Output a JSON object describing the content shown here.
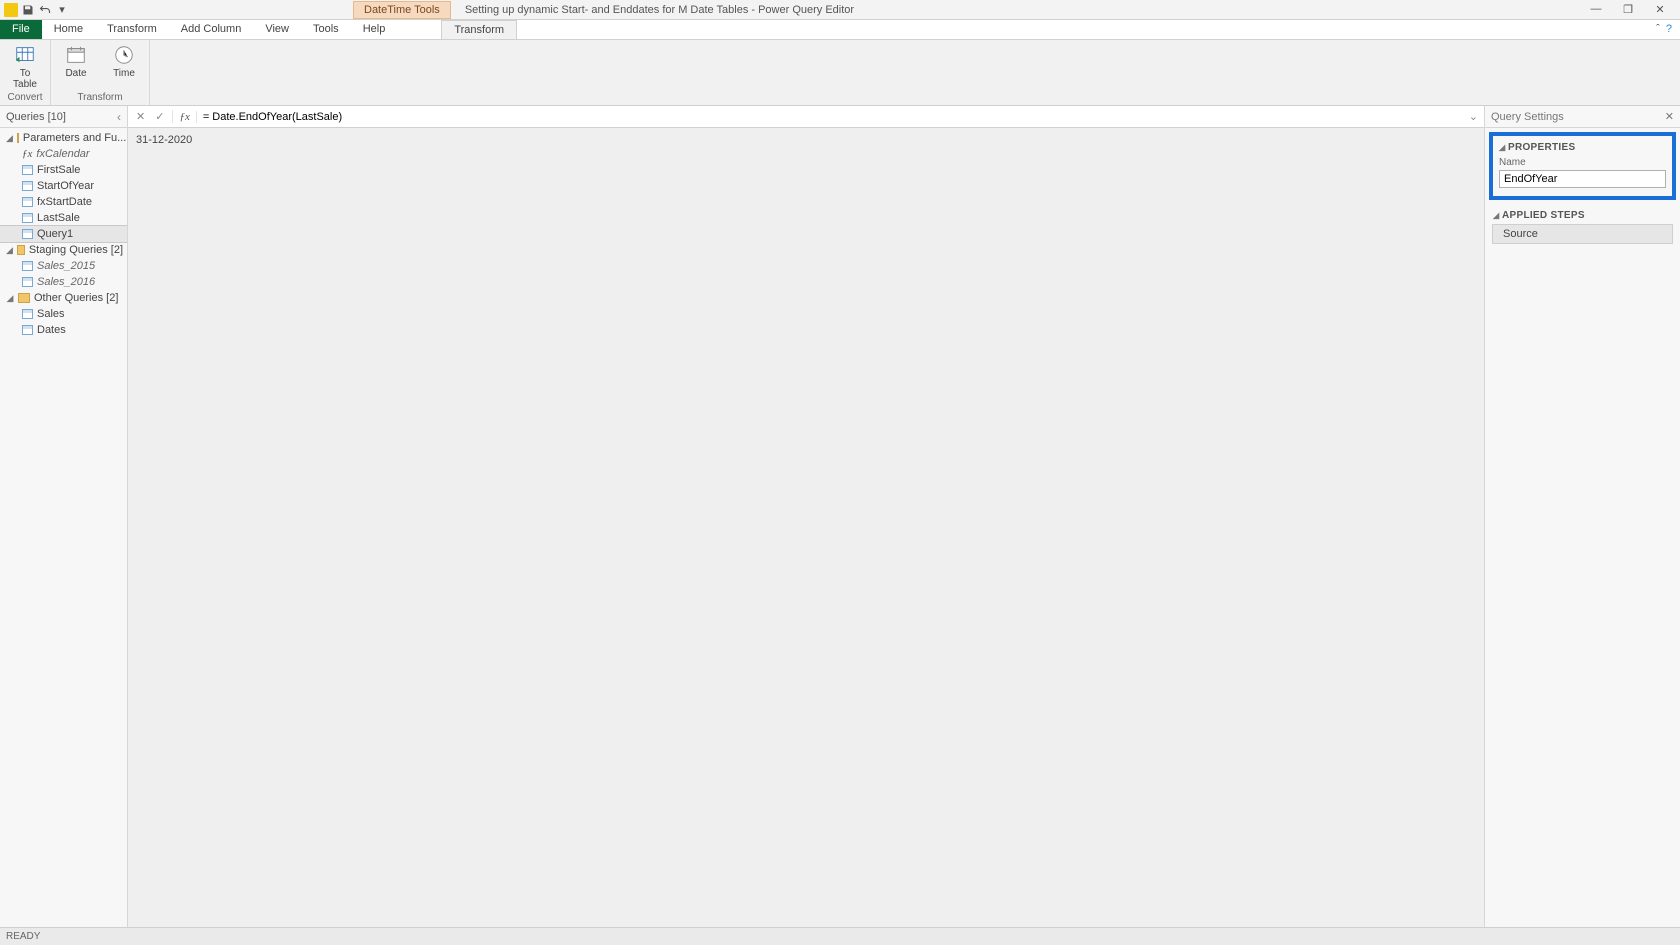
{
  "titlebar": {
    "context_tab": "DateTime Tools",
    "window_title": "Setting up dynamic Start- and Enddates for M Date Tables - Power Query Editor"
  },
  "tabs": {
    "file": "File",
    "home": "Home",
    "transform": "Transform",
    "add_column": "Add Column",
    "view": "View",
    "tools": "Tools",
    "help": "Help",
    "context_transform": "Transform"
  },
  "ribbon": {
    "to_table": "To\nTable",
    "date": "Date",
    "time": "Time",
    "convert_group": "Convert",
    "transform_group": "Transform"
  },
  "queries": {
    "header": "Queries [10]",
    "groups": [
      {
        "name": "Parameters and Fu...",
        "items": [
          {
            "label": "fxCalendar",
            "icon": "fx",
            "italic": true
          },
          {
            "label": "FirstSale",
            "icon": "tbl"
          },
          {
            "label": "StartOfYear",
            "icon": "tbl"
          },
          {
            "label": "fxStartDate",
            "icon": "tbl"
          },
          {
            "label": "LastSale",
            "icon": "tbl"
          },
          {
            "label": "Query1",
            "icon": "tbl",
            "selected": true
          }
        ]
      },
      {
        "name": "Staging Queries [2]",
        "items": [
          {
            "label": "Sales_2015",
            "icon": "tbl",
            "italic": true
          },
          {
            "label": "Sales_2016",
            "icon": "tbl",
            "italic": true
          }
        ]
      },
      {
        "name": "Other Queries [2]",
        "items": [
          {
            "label": "Sales",
            "icon": "tbl"
          },
          {
            "label": "Dates",
            "icon": "tbl"
          }
        ]
      }
    ]
  },
  "formula": {
    "text": "= Date.EndOfYear(LastSale)"
  },
  "result": {
    "value": "31-12-2020"
  },
  "settings": {
    "header": "Query Settings",
    "properties_title": "PROPERTIES",
    "name_label": "Name",
    "name_value": "EndOfYear",
    "applied_title": "APPLIED STEPS",
    "steps": [
      "Source"
    ]
  },
  "statusbar": {
    "text": "READY"
  }
}
